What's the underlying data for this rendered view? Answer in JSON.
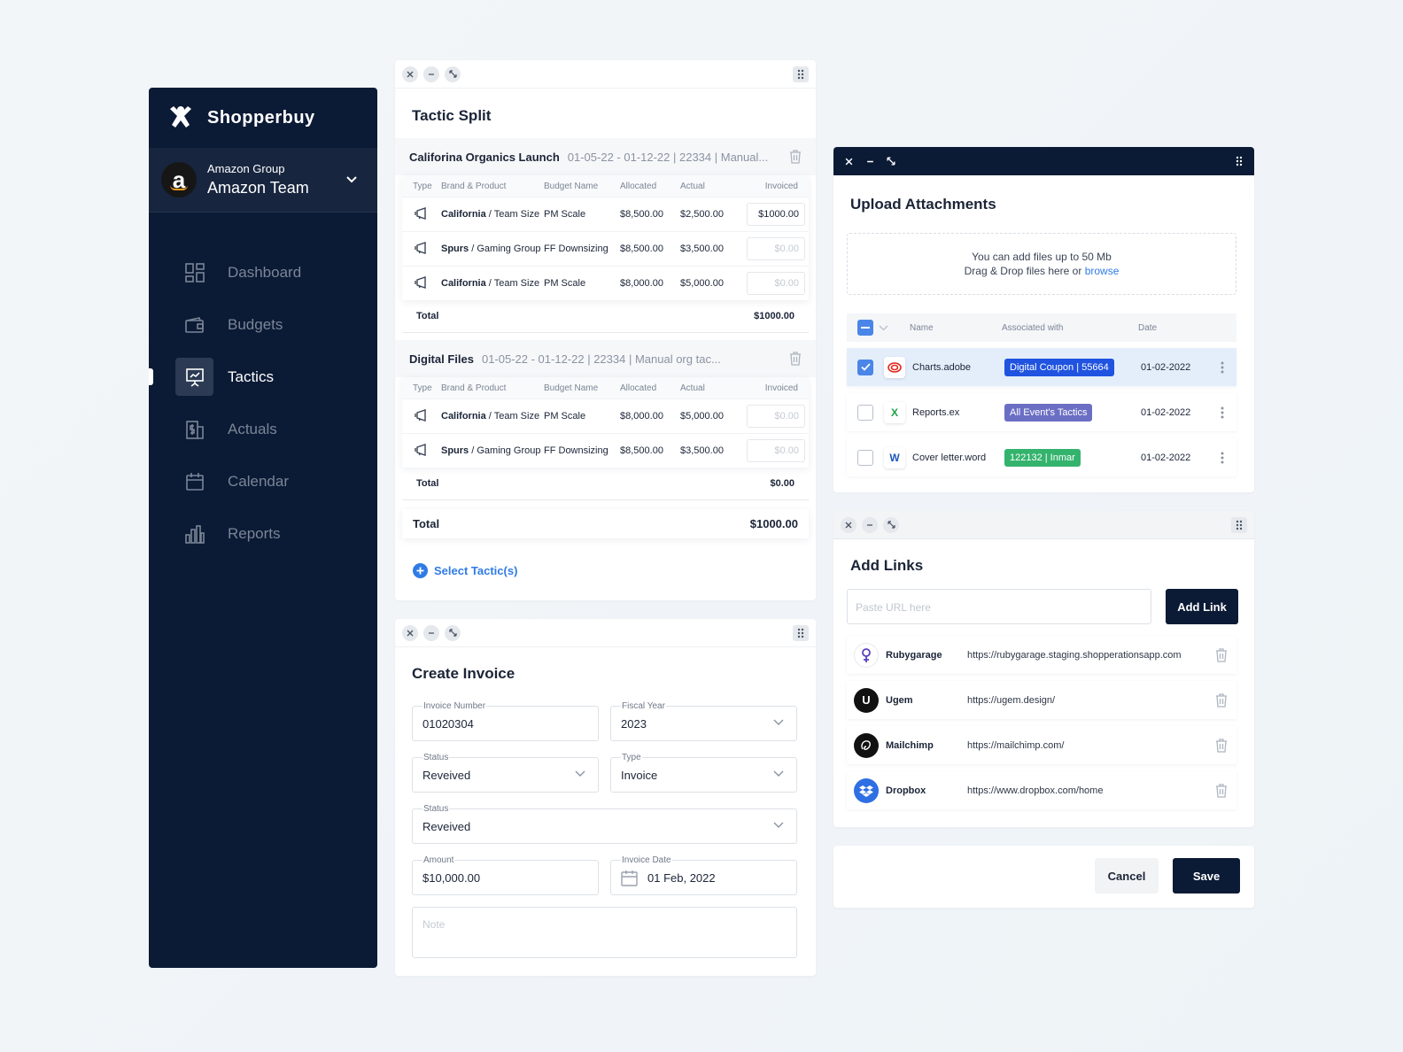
{
  "brand": {
    "name": "Shopperbuy"
  },
  "account": {
    "group": "Amazon Group",
    "team": "Amazon Team",
    "avatar_letter": "a"
  },
  "nav": {
    "items": [
      {
        "label": "Dashboard",
        "icon": "dashboard-icon"
      },
      {
        "label": "Budgets",
        "icon": "wallet-icon"
      },
      {
        "label": "Tactics",
        "icon": "presentation-icon",
        "active": true
      },
      {
        "label": "Actuals",
        "icon": "receipt-dollar-icon"
      },
      {
        "label": "Calendar",
        "icon": "calendar-icon"
      },
      {
        "label": "Reports",
        "icon": "bar-chart-icon"
      }
    ]
  },
  "tactic_split": {
    "title": "Tactic Split",
    "headers": {
      "type": "Type",
      "brand": "Brand & Product",
      "budget": "Budget Name",
      "allocated": "Allocated",
      "actual": "Actual",
      "invoiced": "Invoiced"
    },
    "groups": [
      {
        "name": "Califorina Organics Launch",
        "meta": "01-05-22 - 01-12-22 | 22334 | Manual...",
        "rows": [
          {
            "brand": "California",
            "product": " / Team Size",
            "budget": "PM Scale",
            "allocated": "$8,500.00",
            "actual": "$2,500.00",
            "invoiced": "$1000.00"
          },
          {
            "brand": "Spurs",
            "product": " / Gaming Group",
            "budget": "FF Downsizing",
            "allocated": "$8,500.00",
            "actual": "$3,500.00",
            "invoiced": "$0.00"
          },
          {
            "brand": "California",
            "product": " / Team Size",
            "budget": "PM Scale",
            "allocated": "$8,000.00",
            "actual": "$5,000.00",
            "invoiced": "$0.00"
          }
        ],
        "total_label": "Total",
        "total": "$1000.00"
      },
      {
        "name": "Digital Files",
        "meta": "01-05-22 - 01-12-22 | 22334 | Manual org tac...",
        "rows": [
          {
            "brand": "California",
            "product": " / Team Size",
            "budget": "PM Scale",
            "allocated": "$8,000.00",
            "actual": "$5,000.00",
            "invoiced": "$0.00"
          },
          {
            "brand": "Spurs",
            "product": " / Gaming Group",
            "budget": "FF Downsizing",
            "allocated": "$8,500.00",
            "actual": "$3,500.00",
            "invoiced": "$0.00"
          }
        ],
        "total_label": "Total",
        "total": "$0.00"
      }
    ],
    "grand_total_label": "Total",
    "grand_total": "$1000.00",
    "select_label": "Select Tactic(s)"
  },
  "invoice": {
    "title": "Create Invoice",
    "invoice_number": {
      "label": "Invoice Number",
      "value": "01020304"
    },
    "fiscal_year": {
      "label": "Fiscal Year",
      "value": "2023"
    },
    "status1": {
      "label": "Status",
      "value": "Reveived"
    },
    "type": {
      "label": "Type",
      "value": "Invoice"
    },
    "status2": {
      "label": "Status",
      "value": "Reveived"
    },
    "amount": {
      "label": "Amount",
      "value": "$10,000.00"
    },
    "invoice_date": {
      "label": "Invoice Date",
      "value": "01 Feb, 2022"
    },
    "note_placeholder": "Note"
  },
  "upload": {
    "title": "Upload Attachments",
    "drop_line1": "You can add files up to 50 Mb",
    "drop_line2": "Drag & Drop files here or ",
    "browse": "browse",
    "headers": {
      "name": "Name",
      "associated": "Associated with",
      "date": "Date"
    },
    "files": [
      {
        "name": "Charts.adobe",
        "tag": "Digital Coupon | 55664",
        "tag_color": "#1f53e0",
        "date": "01-02-2022",
        "checked": true,
        "icon": "adobe-icon"
      },
      {
        "name": "Reports.ex",
        "tag": "All Event's Tactics",
        "tag_color": "#6b6fc4",
        "date": "01-02-2022",
        "checked": false,
        "icon": "excel-icon"
      },
      {
        "name": "Cover letter.word",
        "tag": "122132 | Inmar",
        "tag_color": "#34b36d",
        "date": "01-02-2022",
        "checked": false,
        "icon": "word-icon"
      }
    ]
  },
  "links": {
    "title": "Add Links",
    "placeholder": "Paste URL here",
    "add_label": "Add Link",
    "items": [
      {
        "name": "Rubygarage",
        "url": "https://rubygarage.staging.shopperationsapp.com",
        "icon": "rubygarage-logo-icon"
      },
      {
        "name": "Ugem",
        "url": "https://ugem.design/",
        "icon": "ugem-logo-icon"
      },
      {
        "name": "Mailchimp",
        "url": "https://mailchimp.com/",
        "icon": "mailchimp-logo-icon"
      },
      {
        "name": "Dropbox",
        "url": "https://www.dropbox.com/home",
        "icon": "dropbox-logo-icon"
      }
    ]
  },
  "actions": {
    "cancel": "Cancel",
    "save": "Save"
  },
  "colors": {
    "navy": "#0b1a35",
    "accent": "#2f7be6"
  }
}
